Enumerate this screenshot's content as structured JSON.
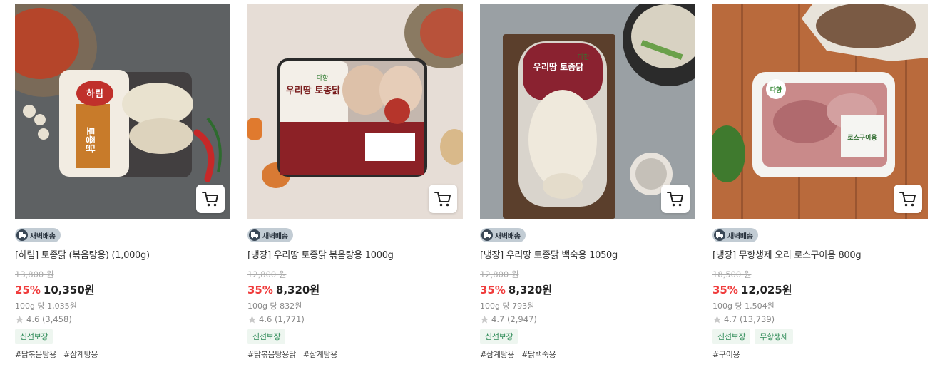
{
  "cart_label": "장바구니",
  "products": [
    {
      "badge": "새벽배송",
      "name": "[하림] 토종닭 (볶음탕용) (1,000g)",
      "original_price": "13,800 원",
      "discount": "25%",
      "price": "10,350원",
      "unit_price": "100g 당 1,035원",
      "rating": "4.6 (3,458)",
      "tags": [
        "신선보장"
      ],
      "hashtags": [
        "#닭볶음탕용",
        "#삼계탕용"
      ],
      "package_label": "토종닭",
      "brand_label": "하림"
    },
    {
      "badge": "새벽배송",
      "name": "[냉장] 우리땅 토종닭 볶음탕용 1000g",
      "original_price": "12,800 원",
      "discount": "35%",
      "price": "8,320원",
      "unit_price": "100g 당 832원",
      "rating": "4.6 (1,771)",
      "tags": [
        "신선보장"
      ],
      "hashtags": [
        "#닭볶음탕용닭",
        "#삼계탕용"
      ],
      "package_label": "우리땅 토종닭",
      "brand_label": "다향"
    },
    {
      "badge": "새벽배송",
      "name": "[냉장] 우리땅 토종닭 백숙용 1050g",
      "original_price": "12,800 원",
      "discount": "35%",
      "price": "8,320원",
      "unit_price": "100g 당 793원",
      "rating": "4.7 (2,947)",
      "tags": [
        "신선보장"
      ],
      "hashtags": [
        "#삼계탕용",
        "#닭백숙용"
      ],
      "package_label": "우리땅 토종닭",
      "brand_label": "다향"
    },
    {
      "badge": "새벽배송",
      "name": "[냉장] 무항생제 오리 로스구이용 800g",
      "original_price": "18,500 원",
      "discount": "35%",
      "price": "12,025원",
      "unit_price": "100g 당 1,504원",
      "rating": "4.7 (13,739)",
      "tags": [
        "신선보장",
        "무항생제"
      ],
      "hashtags": [
        "#구이용"
      ],
      "package_label": "로스구이용",
      "brand_label": "다향"
    }
  ]
}
